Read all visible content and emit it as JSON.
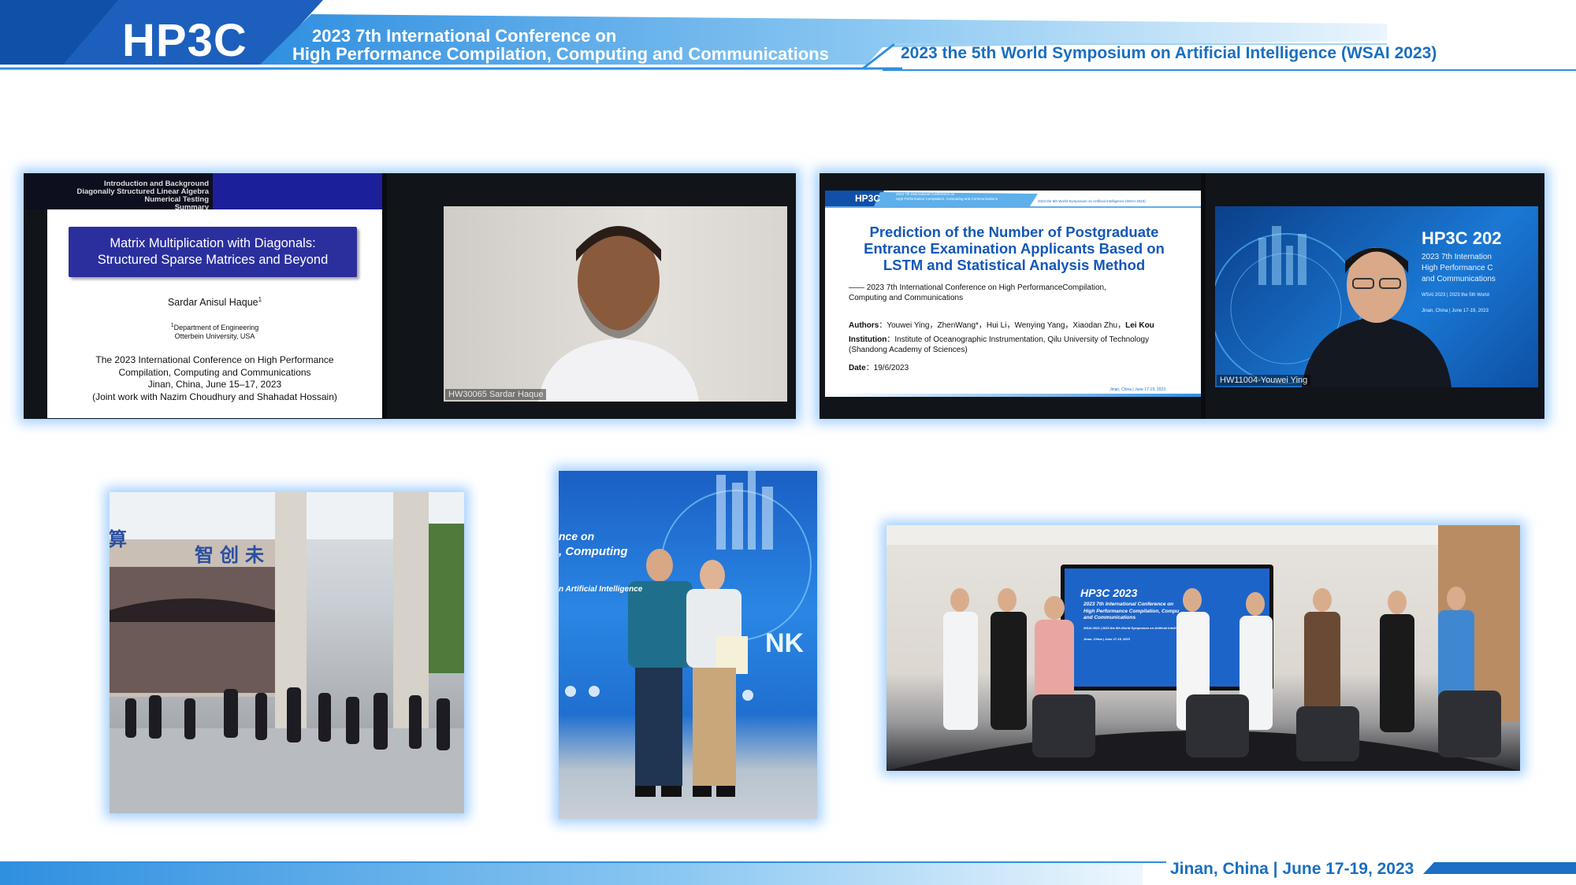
{
  "header": {
    "logo": "HP3C",
    "conference_line1": "2023 7th International Conference on",
    "conference_line2": "High Performance Compilation, Computing and Communications",
    "symposium": "2023 the 5th World Symposium on Artificial Intelligence (WSAI 2023)"
  },
  "footer": {
    "location_date": "Jinan, China | June 17-19, 2023"
  },
  "panel1": {
    "nav_items": [
      "Introduction and Background",
      "Diagonally Structured Linear Algebra",
      "Numerical Testing",
      "Summary"
    ],
    "slide_title_line1": "Matrix Multiplication with Diagonals:",
    "slide_title_line2": "Structured Sparse Matrices and Beyond",
    "author": "Sardar Anisul Haque",
    "author_sup": "1",
    "affil_sup": "1",
    "affil_line1": "Department of Engineering",
    "affil_line2": "Otterbein University, USA",
    "conf_line1": "The 2023 International Conference on High Performance",
    "conf_line2": "Compilation, Computing and Communications",
    "conf_line3": "Jinan, China, June 15–17, 2023",
    "conf_line4": "(Joint work with Nazim Choudhury and Shahadat Hossain)",
    "video_caption": "HW30065 Sardar Haque"
  },
  "panel2": {
    "banner_logo": "HP3C",
    "banner_line1": "2023 7th International Conference on",
    "banner_line2": "High Performance Compilation, Computing and Communications",
    "banner_right": "2023 the 5th World Symposium on Artificial Intelligence (WSAI 2023)",
    "title_line1": "Prediction of the Number of Postgraduate",
    "title_line2": "Entrance Examination Applicants Based on",
    "title_line3": "LSTM and Statistical Analysis Method",
    "conf_line1": "—— 2023 7th International Conference on High PerformanceCompilation,",
    "conf_line2": "Computing and Communications",
    "authors_label": "Authors",
    "authors": "：Youwei Ying，ZhenWang*，Hui Li，Wenying Yang，Xiaodan Zhu，",
    "authors_bold": "Lei Kou",
    "institution_label": "Institution",
    "institution": "：Institute of Oceanographic Instrumentation, Qilu University of Technology",
    "institution_line2": "(Shandong Academy of Sciences)",
    "date_label": "Date",
    "date": "：19/6/2023",
    "slide_footer": "Jinan, China | June 17-19, 2023",
    "video_caption": "HW11004-Youwei Ying",
    "bg_logo": "HP3C 202",
    "bg_line1": "2023 7th Internation",
    "bg_line2": "High Performance C",
    "bg_line3": "and Communications",
    "bg_line4": "WSAI 2023 | 2023 the 5th World",
    "bg_line5": "Jinan, China | June 17-19, 2023"
  },
  "panel3": {
    "sign_chars": "智创未",
    "sign_left": "算"
  },
  "panel4": {
    "backdrop_line1": "nce on",
    "backdrop_line2": ", Computing",
    "backdrop_line3": "n Artificial Intelligence",
    "backdrop_big": "NK"
  },
  "panel5": {
    "screen_logo": "HP3C 2023",
    "screen_line1": "2023 7th International Conference on",
    "screen_line2": "High Performance Compilation, Compu",
    "screen_line3": "and Communications",
    "screen_line4": "WSAI 2023 | 2023 the 5th World Symposium on Artificial Intelli",
    "screen_line5": "Jinan, China | June 17-19, 2023"
  },
  "colors": {
    "brand_dark": "#1150a8",
    "brand_light": "#3aa0e8",
    "accent": "#1a6fc0",
    "slide_purple": "#2b2f9e"
  }
}
